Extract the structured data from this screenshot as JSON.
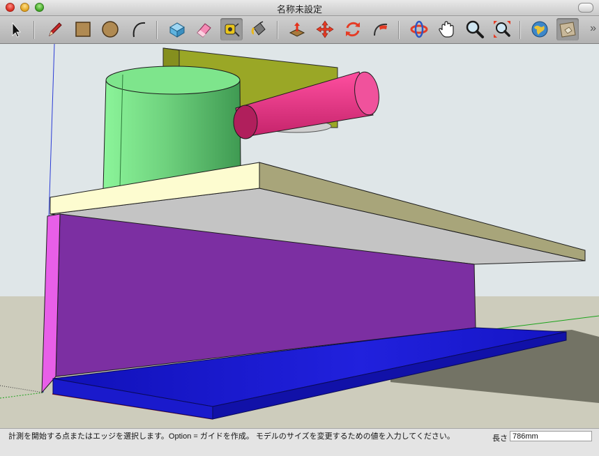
{
  "window": {
    "title": "名称未設定"
  },
  "toolbar": {
    "tools": [
      {
        "name": "select-tool",
        "icon": "arrow-icon"
      },
      {
        "name": "pencil-tool",
        "icon": "pencil-icon"
      },
      {
        "name": "rectangle-tool",
        "icon": "rectangle-icon"
      },
      {
        "name": "circle-tool",
        "icon": "circle-icon"
      },
      {
        "name": "arc-tool",
        "icon": "arc-icon"
      },
      {
        "name": "make-component-tool",
        "icon": "component-icon"
      },
      {
        "name": "eraser-tool",
        "icon": "eraser-icon"
      },
      {
        "name": "tape-measure-tool",
        "icon": "tape-measure-icon",
        "active": true
      },
      {
        "name": "paint-bucket-tool",
        "icon": "paint-bucket-icon"
      },
      {
        "name": "push-pull-tool",
        "icon": "push-pull-icon"
      },
      {
        "name": "move-tool",
        "icon": "move-icon"
      },
      {
        "name": "rotate-tool",
        "icon": "rotate-icon"
      },
      {
        "name": "follow-me-tool",
        "icon": "follow-me-icon"
      },
      {
        "name": "orbit-tool",
        "icon": "orbit-icon"
      },
      {
        "name": "pan-tool",
        "icon": "hand-icon"
      },
      {
        "name": "zoom-tool",
        "icon": "magnifier-icon"
      },
      {
        "name": "zoom-extents-tool",
        "icon": "zoom-extents-icon"
      },
      {
        "name": "get-models-tool",
        "icon": "globe-icon"
      },
      {
        "name": "share-model-tool",
        "icon": "share-model-icon"
      }
    ]
  },
  "status": {
    "hint": "計測を開始する点またはエッジを選択します。Option = ガイドを作成。 モデルのサイズを変更するための値を入力してください。",
    "measure_label": "長さ",
    "measure_value": "786mm"
  },
  "colors": {
    "sky": "#dfe6e8",
    "ground": "#cdccbc",
    "cylinder_green": "#6fd27e",
    "cylinder_pink": "#e83c86",
    "back_panel": "#9aa726",
    "shelf_top": "#fdfcd0",
    "shelf_side": "#a8a57a",
    "shelf_under": "#c4c4c4",
    "wall_purple": "#7c2fa2",
    "wall_edge": "#e85fe8",
    "base_blue": "#1a1acc"
  }
}
